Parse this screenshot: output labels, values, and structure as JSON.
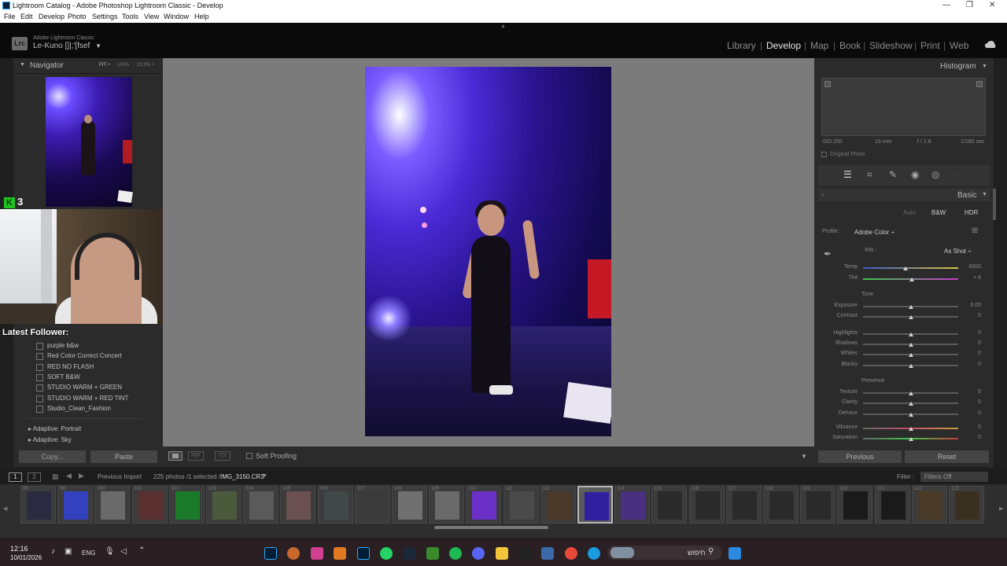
{
  "window": {
    "title": "Lightroom Catalog - Adobe Photoshop Lightroom Classic - Develop",
    "controls": [
      "—",
      "❐",
      "✕"
    ]
  },
  "menu": [
    "File",
    "Edit",
    "Develop",
    "Photo",
    "Settings",
    "Tools",
    "View",
    "Window",
    "Help"
  ],
  "identity": {
    "logo": "Lrc",
    "product": "Adobe Lightroom Classic",
    "name": "Le-Kuno []|;'[fsef",
    "dropdown": "▼"
  },
  "modules": [
    {
      "label": "Library",
      "active": false
    },
    {
      "label": "Develop",
      "active": true
    },
    {
      "label": "Map",
      "active": false
    },
    {
      "label": "Book",
      "active": false
    },
    {
      "label": "Slideshow",
      "active": false
    },
    {
      "label": "Print",
      "active": false
    },
    {
      "label": "Web",
      "active": false
    }
  ],
  "navigator": {
    "title": "Navigator",
    "zoom": [
      "FIT ÷",
      "100%",
      "33.3% ÷"
    ]
  },
  "overlay": {
    "badge_letter": "K",
    "badge_count": "3",
    "follower_label": "Latest Follower:"
  },
  "presets": {
    "items": [
      "purple b&w",
      "Red Color Correct Concert",
      "RED NO FLASH",
      "SOFT B&W",
      "STUDIO WARM + GREEN",
      "STUDIO WARM + RED TINT",
      "Studio_Clean_Fashion"
    ],
    "folders": [
      "Adaptive: Portrait",
      "Adaptive: Sky"
    ]
  },
  "left_buttons": {
    "copy": "Copy...",
    "paste": "Paste"
  },
  "toolbar": {
    "soft_proofing": "Soft Proofing"
  },
  "histogram": {
    "title": "Histogram",
    "iso": "ISO 250",
    "focal": "15 mm",
    "aperture": "f / 2.8",
    "shutter": "1/180 sec",
    "original_photo": "Original Photo"
  },
  "basic": {
    "title": "Basic",
    "treatment": [
      "Auto",
      "B&W",
      "HDR"
    ],
    "profile_label": "Profile :",
    "profile_value": "Adobe Color ÷",
    "wb_label": "WB :",
    "wb_value": "As Shot ÷",
    "tone_label": "Tone",
    "presence_label": "Presence",
    "sliders": {
      "temp": {
        "label": "Temp",
        "value": "6600",
        "pos": 0.45
      },
      "tint": {
        "label": "Tint",
        "value": "+ 6",
        "pos": 0.51
      },
      "exposure": {
        "label": "Exposure",
        "value": "0.00",
        "pos": 0.5
      },
      "contrast": {
        "label": "Contrast",
        "value": "0",
        "pos": 0.5
      },
      "highlights": {
        "label": "Highlights",
        "value": "0",
        "pos": 0.5
      },
      "shadows": {
        "label": "Shadows",
        "value": "0",
        "pos": 0.5
      },
      "whites": {
        "label": "Whites",
        "value": "0",
        "pos": 0.5
      },
      "blacks": {
        "label": "Blacks",
        "value": "0",
        "pos": 0.5
      },
      "texture": {
        "label": "Texture",
        "value": "0",
        "pos": 0.5
      },
      "clarity": {
        "label": "Clarity",
        "value": "0",
        "pos": 0.5
      },
      "dehaze": {
        "label": "Dehaze",
        "value": "0",
        "pos": 0.5
      },
      "vibrance": {
        "label": "Vibrance",
        "value": "0",
        "pos": 0.5
      },
      "saturation": {
        "label": "Saturation",
        "value": "0",
        "pos": 0.5
      }
    }
  },
  "right_buttons": {
    "previous": "Previous",
    "reset": "Reset"
  },
  "filmbar": {
    "pages": [
      "1",
      "2"
    ],
    "source": "Previous Import",
    "count": "225 photos /1 selected /",
    "filename": "IMG_3150.CR3",
    "filter_label": "Filter :",
    "filter_value": "Filters Off"
  },
  "filmstrip": {
    "numbers": [
      "98",
      "99",
      "100",
      "101",
      "102",
      "103",
      "104",
      "105",
      "106",
      "107",
      "108",
      "109",
      "110",
      "111",
      "112",
      "113",
      "114",
      "115",
      "116",
      "117",
      "118",
      "119",
      "120",
      "121",
      "122",
      "123"
    ],
    "thumb_colors": [
      "#2a2a40",
      "#3340c0",
      "#6a6a6a",
      "#5a3030",
      "#1a7a2a",
      "#4a5a3a",
      "#5a5a5a",
      "#6a5050",
      "#404848",
      "#3a3a3a",
      "#707070",
      "#6a6a6a",
      "#6a30c8",
      "#4a4a4a",
      "#4a3828",
      "#3020a0",
      "#4a3080",
      "#2a2a2a",
      "#2a2a2a",
      "#2a2a2a",
      "#2a2a2a",
      "#2a2a2a",
      "#1a1a1a",
      "#1a1a1a",
      "#4a3a28",
      "#3a3020"
    ],
    "selected_index": 15
  },
  "taskbar": {
    "time": "12:16",
    "date": "10/01/2026",
    "lang": "ENG",
    "search_text": "חיפוש"
  }
}
